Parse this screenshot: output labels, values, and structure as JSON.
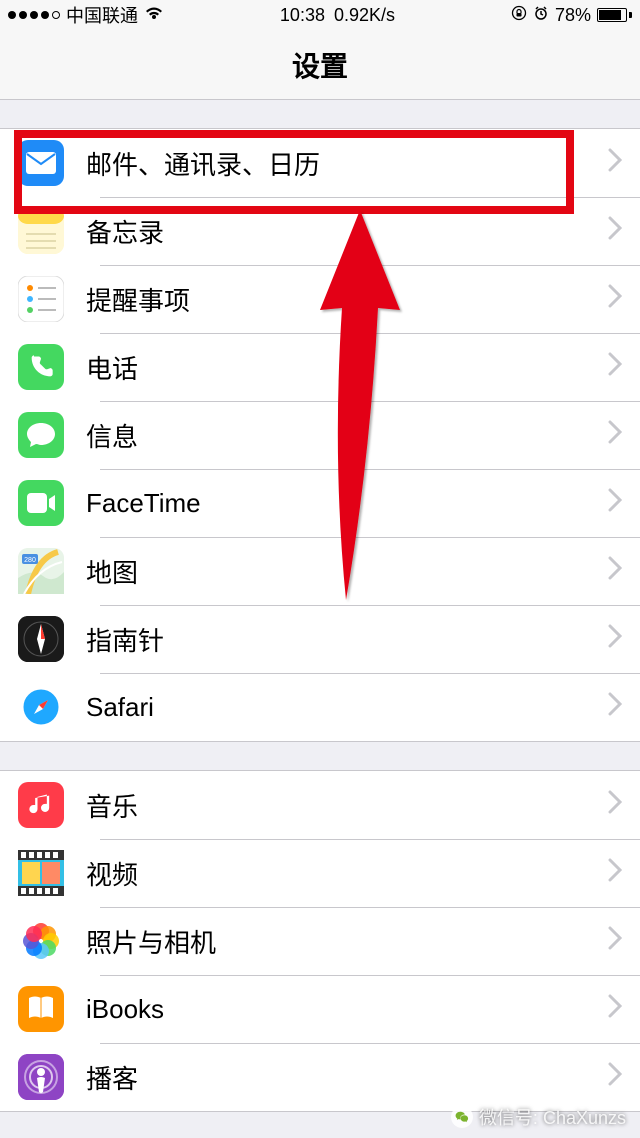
{
  "status": {
    "carrier": "中国联通",
    "time": "10:38",
    "speed": "0.92K/s",
    "battery": "78%"
  },
  "nav": {
    "title": "设置"
  },
  "groups": [
    {
      "rows": [
        {
          "name": "mail",
          "label": "邮件、通讯录、日历",
          "icon": "mail-icon",
          "bg": "#1f8bf7"
        },
        {
          "name": "notes",
          "label": "备忘录",
          "icon": "notes-icon",
          "bg": "linear-gradient(#fff176 40%,#fff9c4 40%)"
        },
        {
          "name": "reminders",
          "label": "提醒事项",
          "icon": "reminders-icon",
          "bg": "#ffffff"
        },
        {
          "name": "phone",
          "label": "电话",
          "icon": "phone-icon",
          "bg": "#44d860"
        },
        {
          "name": "messages",
          "label": "信息",
          "icon": "messages-icon",
          "bg": "#44d860"
        },
        {
          "name": "facetime",
          "label": "FaceTime",
          "icon": "facetime-icon",
          "bg": "#44d860"
        },
        {
          "name": "maps",
          "label": "地图",
          "icon": "maps-icon",
          "bg": "#eef5ee"
        },
        {
          "name": "compass",
          "label": "指南针",
          "icon": "compass-icon",
          "bg": "#1a1a1a"
        },
        {
          "name": "safari",
          "label": "Safari",
          "icon": "safari-icon",
          "bg": "#ffffff"
        }
      ]
    },
    {
      "rows": [
        {
          "name": "music",
          "label": "音乐",
          "icon": "music-icon",
          "bg": "#ff3b49"
        },
        {
          "name": "videos",
          "label": "视频",
          "icon": "videos-icon",
          "bg": "#33bfe5"
        },
        {
          "name": "photos",
          "label": "照片与相机",
          "icon": "photos-icon",
          "bg": "#ffffff"
        },
        {
          "name": "ibooks",
          "label": "iBooks",
          "icon": "ibooks-icon",
          "bg": "#ff9500"
        },
        {
          "name": "podcasts",
          "label": "播客",
          "icon": "podcasts-icon",
          "bg": "#8e44c4"
        }
      ]
    }
  ],
  "annotation": {
    "highlight_row": 0
  },
  "watermark": {
    "text": "微信号: ChaXunzs"
  }
}
